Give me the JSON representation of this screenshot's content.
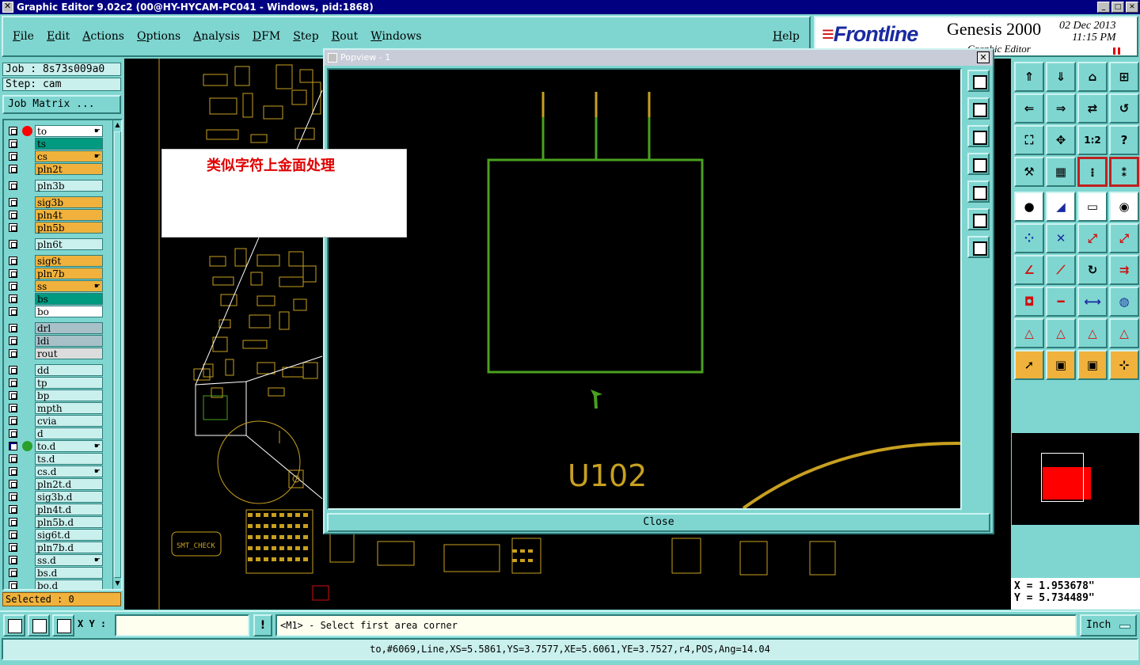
{
  "window": {
    "title": "Graphic Editor 9.02c2 (00@HY-HYCAM-PC041 - Windows, pid:1868)"
  },
  "menu": [
    "File",
    "Edit",
    "Actions",
    "Options",
    "Analysis",
    "DFM",
    "Step",
    "Rout",
    "Windows"
  ],
  "help_label": "Help",
  "logo": {
    "brand": "Frontline",
    "product": "Genesis 2000",
    "subtitle": "Graphic Editor",
    "date": "02  Dec 2013",
    "time": "11:15  PM"
  },
  "job": {
    "job_label": "Job : 8s73s009a0",
    "step_label": "Step: cam"
  },
  "job_matrix_label": "Job Matrix ...",
  "layers": [
    {
      "name": "to",
      "color": "#ffffff",
      "dot": "#ff0000",
      "hand": true
    },
    {
      "name": "ts",
      "color": "#009a80"
    },
    {
      "name": "cs",
      "color": "#f0b23c",
      "hand": true
    },
    {
      "name": "pln2t",
      "color": "#f0b23c"
    },
    {
      "name": "pln3b",
      "color": "#c9f0ed"
    },
    {
      "name": "sig3b",
      "color": "#f0b23c"
    },
    {
      "name": "pln4t",
      "color": "#f0b23c"
    },
    {
      "name": "pln5b",
      "color": "#f0b23c"
    },
    {
      "name": "pln6t",
      "color": "#c9f0ed"
    },
    {
      "name": "sig6t",
      "color": "#f0b23c"
    },
    {
      "name": "pln7b",
      "color": "#f0b23c"
    },
    {
      "name": "ss",
      "color": "#f0b23c",
      "hand": true
    },
    {
      "name": "bs",
      "color": "#009a80"
    },
    {
      "name": "bo",
      "color": "#ffffff"
    },
    {
      "name": "drl",
      "color": "#a8c0c8"
    },
    {
      "name": "ldi",
      "color": "#a8c0c8"
    },
    {
      "name": "rout",
      "color": "#dcdcdc"
    },
    {
      "name": "dd",
      "color": "#c9f0ed"
    },
    {
      "name": "tp",
      "color": "#c9f0ed"
    },
    {
      "name": "bp",
      "color": "#c9f0ed"
    },
    {
      "name": "mpth",
      "color": "#c9f0ed"
    },
    {
      "name": "cvia",
      "color": "#c9f0ed"
    },
    {
      "name": "d",
      "color": "#c9f0ed"
    },
    {
      "name": "to.d",
      "color": "#c9f0ed",
      "dot": "#2aa02a",
      "checked": true,
      "hand": true
    },
    {
      "name": "ts.d",
      "color": "#c9f0ed"
    },
    {
      "name": "cs.d",
      "color": "#c9f0ed",
      "hand": true
    },
    {
      "name": "pln2t.d",
      "color": "#c9f0ed"
    },
    {
      "name": "sig3b.d",
      "color": "#c9f0ed"
    },
    {
      "name": "pln4t.d",
      "color": "#c9f0ed"
    },
    {
      "name": "pln5b.d",
      "color": "#c9f0ed"
    },
    {
      "name": "sig6t.d",
      "color": "#c9f0ed"
    },
    {
      "name": "pln7b.d",
      "color": "#c9f0ed"
    },
    {
      "name": "ss.d",
      "color": "#c9f0ed",
      "hand": true
    },
    {
      "name": "bs.d",
      "color": "#c9f0ed"
    },
    {
      "name": "bo.d",
      "color": "#c9f0ed"
    }
  ],
  "selected_label": "Selected : 0",
  "popview": {
    "title": "Popview - 1",
    "component_label": "U102",
    "close_label": "Close"
  },
  "annotation": "类似字符上金面处理",
  "canvas_labels": {
    "smt_check": "SMT_CHECK"
  },
  "coords": {
    "x": "X = 1.953678\"",
    "y": "Y = 5.734489\""
  },
  "bottom": {
    "xy_label": "X Y :",
    "xy_value": "",
    "prompt": "<M1> - Select first area corner",
    "unit": "Inch"
  },
  "status_line": "to,#6069,Line,XS=5.5861,YS=3.7577,XE=5.6061,YE=3.7527,r4,POS,Ang=14.04",
  "colors": {
    "panel": "#7fd6d1",
    "title_bar": "#000080",
    "board_yellow": "#c8a020",
    "outline_green": "#4aa020",
    "annotation_red": "#e00000"
  }
}
